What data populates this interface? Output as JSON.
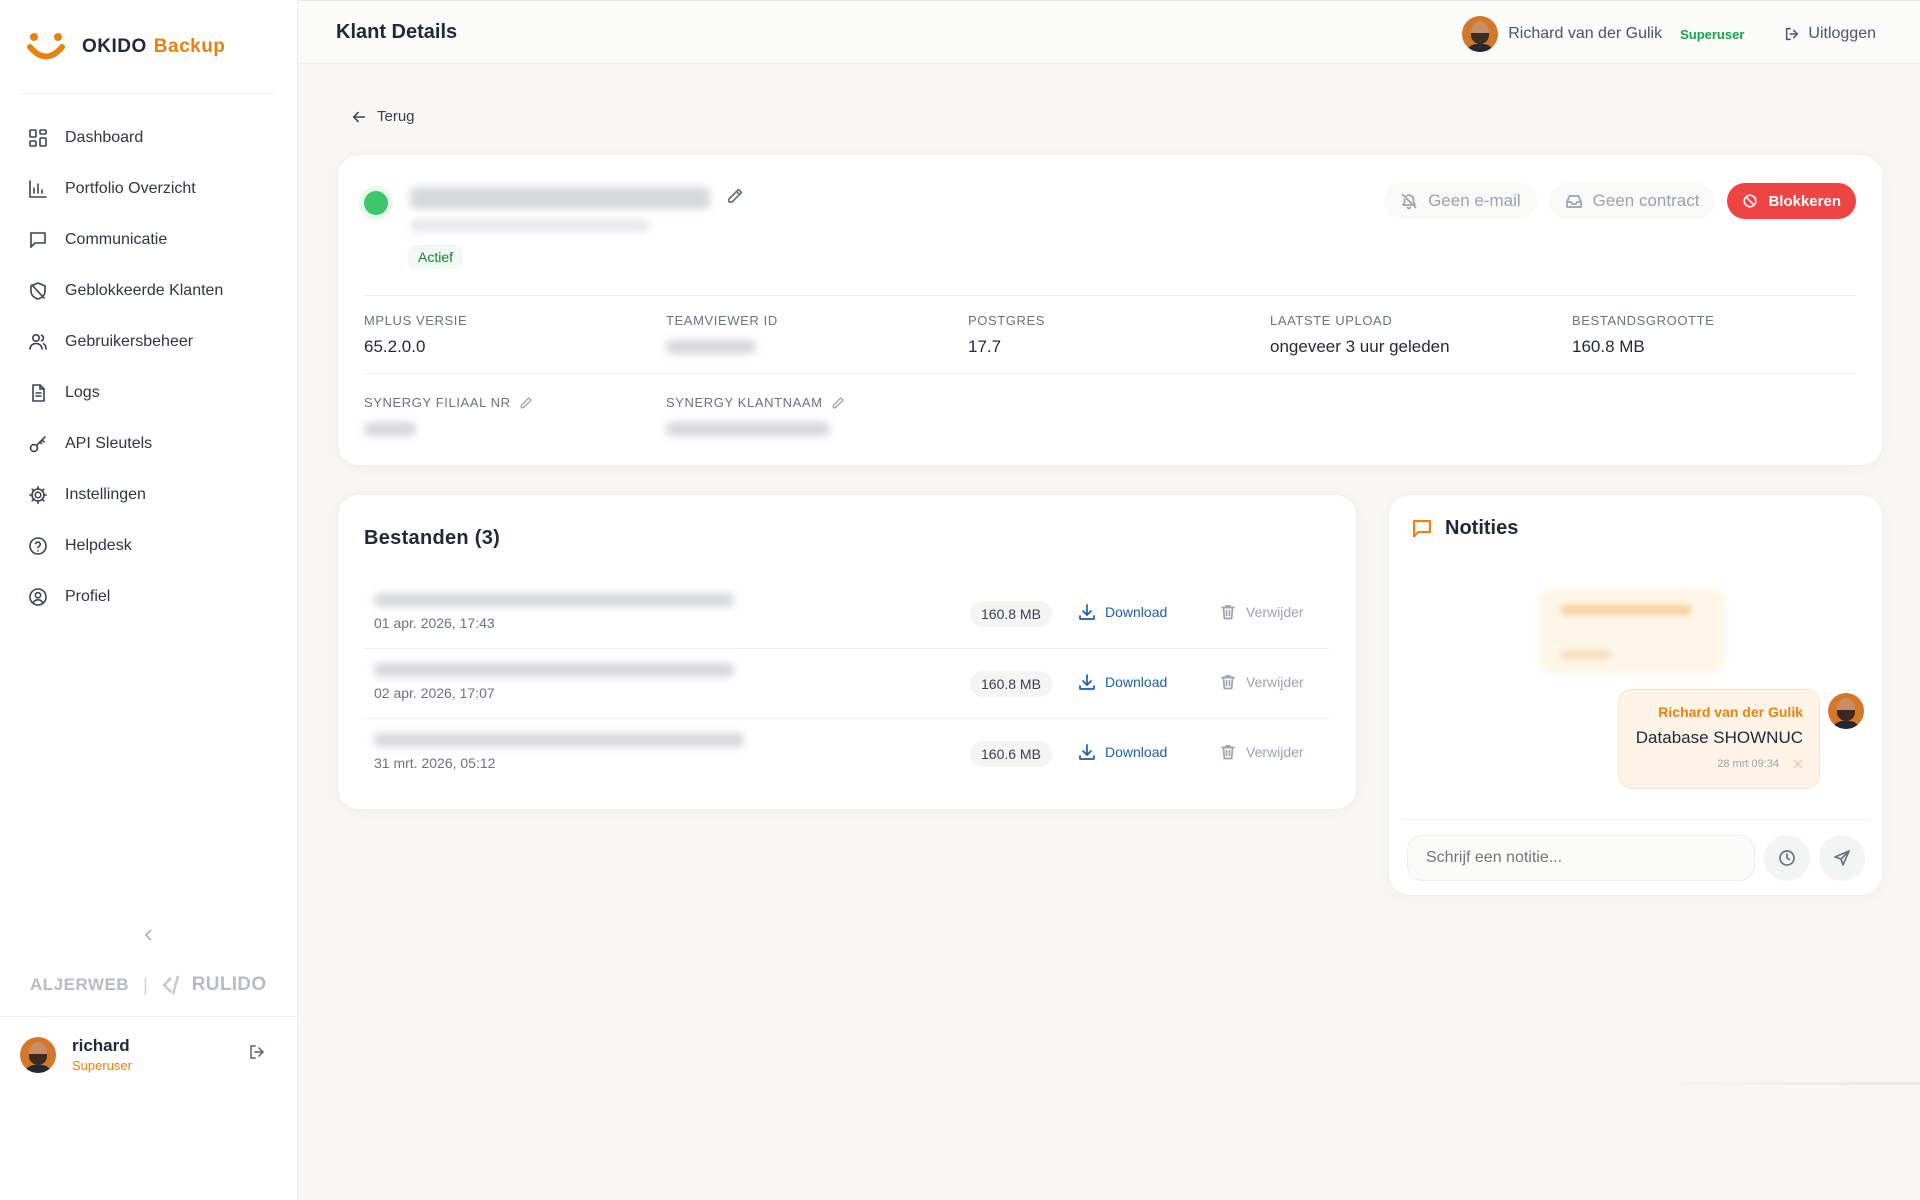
{
  "brand": {
    "name": "OKIDO",
    "accent": "Backup",
    "accent_color": "#e8820e"
  },
  "sidebar": {
    "items": [
      {
        "label": "Dashboard",
        "icon": "grid-icon"
      },
      {
        "label": "Portfolio Overzicht",
        "icon": "bar-chart-icon"
      },
      {
        "label": "Communicatie",
        "icon": "message-icon"
      },
      {
        "label": "Geblokkeerde Klanten",
        "icon": "shield-off-icon"
      },
      {
        "label": "Gebruikersbeheer",
        "icon": "users-icon"
      },
      {
        "label": "Logs",
        "icon": "file-text-icon"
      },
      {
        "label": "API Sleutels",
        "icon": "key-icon"
      },
      {
        "label": "Instellingen",
        "icon": "gear-icon"
      },
      {
        "label": "Helpdesk",
        "icon": "help-circle-icon"
      },
      {
        "label": "Profiel",
        "icon": "user-circle-icon"
      }
    ],
    "collapse_icon": "chevron-left-icon",
    "partners": {
      "left": "ALJERWEB",
      "separator": "|",
      "right": "RULIDO"
    },
    "user": {
      "name": "richard",
      "role": "Superuser"
    }
  },
  "header": {
    "title": "Klant Details",
    "user_name": "Richard van der Gulik",
    "user_role": "Superuser",
    "logout_label": "Uitloggen"
  },
  "back_label": "Terug",
  "customer": {
    "status": "Actief",
    "status_color": "#3fc66d",
    "actions": {
      "email": "Geen e-mail",
      "contract": "Geen contract",
      "block": "Blokkeren"
    },
    "block_color": "#ef4444",
    "fields": {
      "mplus_label": "MPLUS VERSIE",
      "mplus_value": "65.2.0.0",
      "teamviewer_label": "TEAMVIEWER ID",
      "postgres_label": "POSTGRES",
      "postgres_value": "17.7",
      "upload_label": "LAATSTE UPLOAD",
      "upload_value": "ongeveer 3 uur geleden",
      "size_label": "BESTANDSGROOTTE",
      "size_value": "160.8 MB",
      "synergy_nr_label": "SYNERGY FILIAAL NR",
      "synergy_name_label": "SYNERGY KLANTNAAM"
    }
  },
  "files": {
    "title": "Bestanden (3)",
    "download_label": "Download",
    "delete_label": "Verwijder",
    "rows": [
      {
        "date": "01 apr. 2026, 17:43",
        "size": "160.8 MB"
      },
      {
        "date": "02 apr. 2026, 17:07",
        "size": "160.8 MB"
      },
      {
        "date": "31 mrt. 2026, 05:12",
        "size": "160.6 MB"
      }
    ]
  },
  "notes": {
    "title": "Notities",
    "note": {
      "author": "Richard van der Gulik",
      "text": "Database SHOWNUC",
      "time": "28 mrt 09:34"
    },
    "input_placeholder": "Schrijf een notitie..."
  }
}
